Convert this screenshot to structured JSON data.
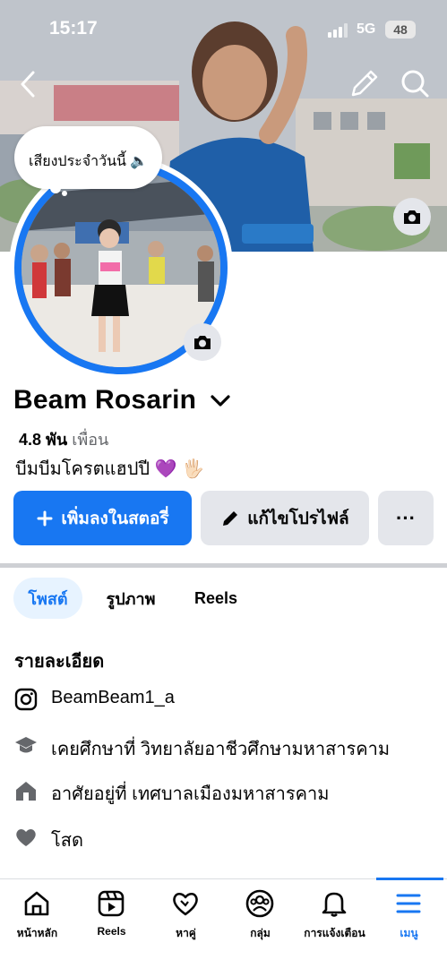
{
  "status_bar": {
    "time": "15:17",
    "network": "5G",
    "battery": "48"
  },
  "profile": {
    "note": "เสียงประจำวันนี้ 🔈",
    "name": "Beam Rosarin",
    "friends_count": "4.8 พัน",
    "friends_label": "เพื่อน",
    "bio": "บีมบีมโครตแฮปปี 💜 🖐🏻"
  },
  "actions": {
    "add_story": "เพิ่มลงในสตอรี่",
    "edit_profile": "แก้ไขโปรไฟล์",
    "more": "···"
  },
  "tabs": [
    {
      "label": "โพสต์",
      "active": true
    },
    {
      "label": "รูปภาพ",
      "active": false
    },
    {
      "label": "Reels",
      "active": false
    }
  ],
  "details": {
    "title": "รายละเอียด",
    "items": [
      {
        "icon": "instagram-icon",
        "text": "BeamBeam1_a"
      },
      {
        "icon": "graduation-cap-icon",
        "text": "เคยศึกษาที่ วิทยาลัยอาชีวศึกษามหาสารคาม"
      },
      {
        "icon": "home-icon",
        "text": "อาศัยอยู่ที่ เทศบาลเมืองมหาสารคาม"
      },
      {
        "icon": "heart-icon",
        "text": "โสด"
      }
    ]
  },
  "bottom_nav": [
    {
      "label": "หน้าหลัก",
      "icon": "home-icon"
    },
    {
      "label": "Reels",
      "icon": "reels-icon"
    },
    {
      "label": "หาคู่",
      "icon": "dating-heart-icon"
    },
    {
      "label": "กลุ่ม",
      "icon": "groups-icon"
    },
    {
      "label": "การแจ้งเตือน",
      "icon": "bell-icon"
    },
    {
      "label": "เมนู",
      "icon": "menu-icon",
      "active": true
    }
  ],
  "colors": {
    "accent": "#1877f2",
    "secondary_button": "#e4e6eb",
    "text": "#050505",
    "muted": "#65676b"
  }
}
